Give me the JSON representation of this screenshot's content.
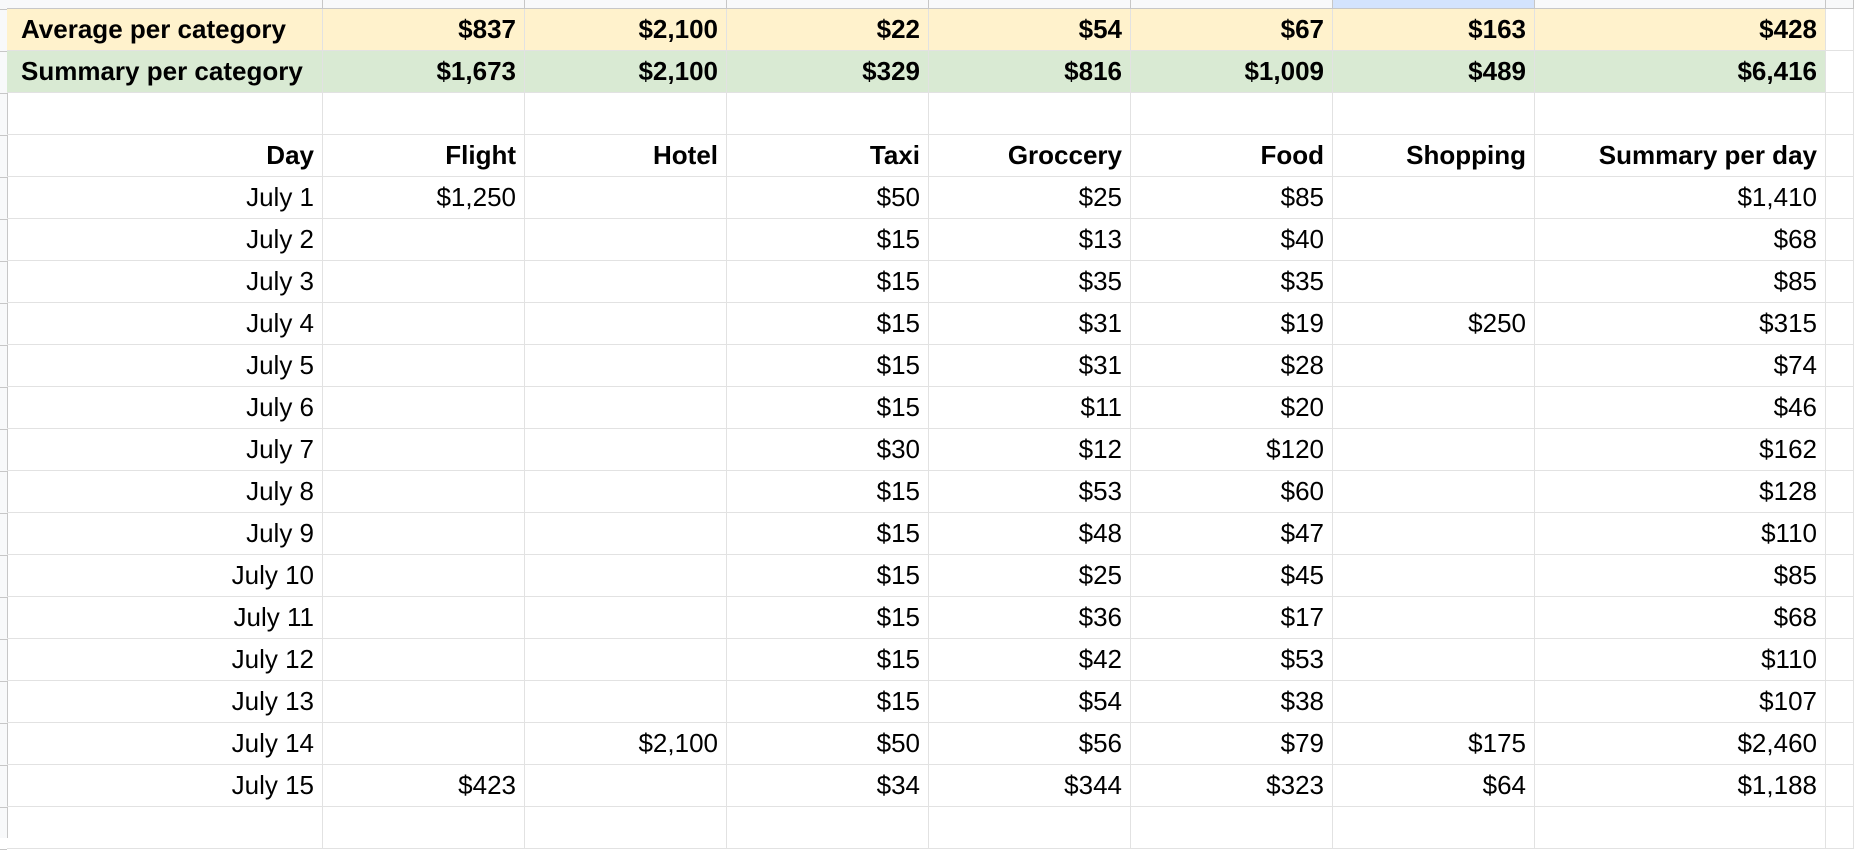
{
  "colors": {
    "average_row_bg": "#fff2cc",
    "summary_row_bg": "#d9ead3",
    "gridline": "#e2e2e2",
    "selected_column_header": "#d3e3fd"
  },
  "average_row": {
    "label": "Average per category",
    "values": [
      "$837",
      "$2,100",
      "$22",
      "$54",
      "$67",
      "$163",
      "$428"
    ]
  },
  "summary_row": {
    "label": "Summary per category",
    "values": [
      "$1,673",
      "$2,100",
      "$329",
      "$816",
      "$1,009",
      "$489",
      "$6,416"
    ]
  },
  "table": {
    "headers": [
      "Day",
      "Flight",
      "Hotel",
      "Taxi",
      "Groccery",
      "Food",
      "Shopping",
      "Summary per day"
    ],
    "rows": [
      [
        "July 1",
        "$1,250",
        "",
        "$50",
        "$25",
        "$85",
        "",
        "$1,410"
      ],
      [
        "July 2",
        "",
        "",
        "$15",
        "$13",
        "$40",
        "",
        "$68"
      ],
      [
        "July 3",
        "",
        "",
        "$15",
        "$35",
        "$35",
        "",
        "$85"
      ],
      [
        "July 4",
        "",
        "",
        "$15",
        "$31",
        "$19",
        "$250",
        "$315"
      ],
      [
        "July 5",
        "",
        "",
        "$15",
        "$31",
        "$28",
        "",
        "$74"
      ],
      [
        "July 6",
        "",
        "",
        "$15",
        "$11",
        "$20",
        "",
        "$46"
      ],
      [
        "July 7",
        "",
        "",
        "$30",
        "$12",
        "$120",
        "",
        "$162"
      ],
      [
        "July 8",
        "",
        "",
        "$15",
        "$53",
        "$60",
        "",
        "$128"
      ],
      [
        "July 9",
        "",
        "",
        "$15",
        "$48",
        "$47",
        "",
        "$110"
      ],
      [
        "July 10",
        "",
        "",
        "$15",
        "$25",
        "$45",
        "",
        "$85"
      ],
      [
        "July 11",
        "",
        "",
        "$15",
        "$36",
        "$17",
        "",
        "$68"
      ],
      [
        "July 12",
        "",
        "",
        "$15",
        "$42",
        "$53",
        "",
        "$110"
      ],
      [
        "July 13",
        "",
        "",
        "$15",
        "$54",
        "$38",
        "",
        "$107"
      ],
      [
        "July 14",
        "",
        "$2,100",
        "$50",
        "$56",
        "$79",
        "$175",
        "$2,460"
      ],
      [
        "July 15",
        "$423",
        "",
        "$34",
        "$344",
        "$323",
        "$64",
        "$1,188"
      ]
    ]
  }
}
